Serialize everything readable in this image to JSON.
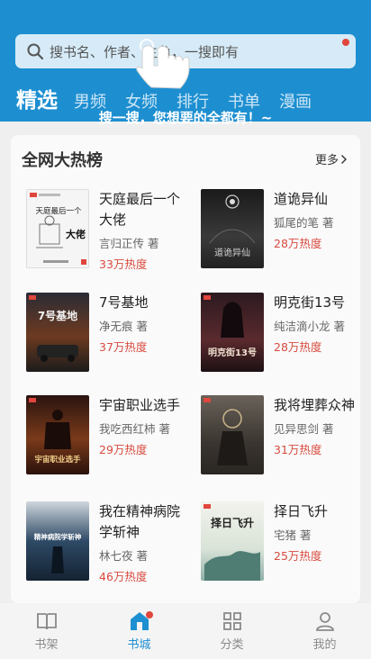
{
  "search": {
    "placeholder": "搜书名、作者、主角，一搜即有"
  },
  "tabs": [
    {
      "label": "精选"
    },
    {
      "label": "男频"
    },
    {
      "label": "女频"
    },
    {
      "label": "排行"
    },
    {
      "label": "书单"
    },
    {
      "label": "漫画"
    }
  ],
  "tip": "搜一搜，您想要的全都有！~",
  "ranking": {
    "title": "全网大热榜",
    "more": "更多"
  },
  "books": [
    {
      "title": "天庭最后一个大佬",
      "author": "言归正传 著",
      "heat": "33万热度",
      "cover_text": "天庭最后一个",
      "cover_big": "大佬",
      "cover_color": "#f5f5f5"
    },
    {
      "title": "道诡异仙",
      "author": "狐尾的笔 著",
      "heat": "28万热度",
      "cover_text": "道诡异仙",
      "cover_color": "#2a2a2a"
    },
    {
      "title": "7号基地",
      "author": "净无痕 著",
      "heat": "37万热度",
      "cover_text": "7号基地",
      "cover_color": "#5a2e1c"
    },
    {
      "title": "明克街13号",
      "author": "纯洁滴小龙 著",
      "heat": "28万热度",
      "cover_text": "明克街13号",
      "cover_color": "#3a1f22"
    },
    {
      "title": "宇宙职业选手",
      "author": "我吃西红柿 著",
      "heat": "29万热度",
      "cover_text": "宇宙职业选手",
      "cover_color": "#3b1d14"
    },
    {
      "title": "我将埋葬众神",
      "author": "见异思剑 著",
      "heat": "31万热度",
      "cover_text": "",
      "cover_color": "#4a4340"
    },
    {
      "title": "我在精神病院学斩神",
      "author": "林七夜 著",
      "heat": "46万热度",
      "cover_text": "精神病院学斩神",
      "cover_color": "#1e3448"
    },
    {
      "title": "择日飞升",
      "author": "宅猪 著",
      "heat": "25万热度",
      "cover_text": "择日飞升",
      "cover_color": "#e8ece0"
    }
  ],
  "nav": [
    {
      "label": "书架",
      "icon": "bookshelf-icon"
    },
    {
      "label": "书城",
      "icon": "store-icon"
    },
    {
      "label": "分类",
      "icon": "category-icon"
    },
    {
      "label": "我的",
      "icon": "profile-icon"
    }
  ],
  "colors": {
    "brand": "#1d8fd1",
    "heat": "#d84a3f",
    "badge": "#e0463c"
  }
}
